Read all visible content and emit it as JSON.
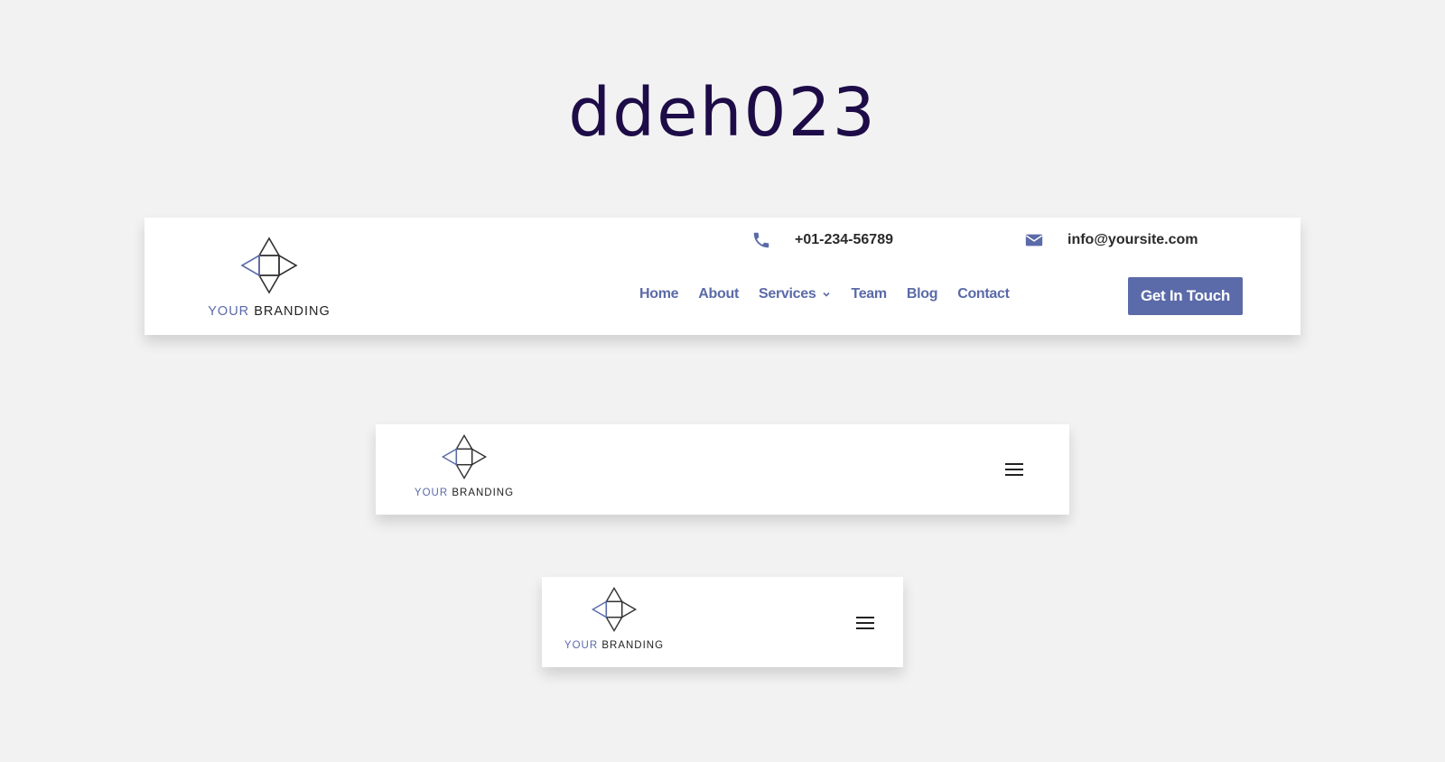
{
  "page": {
    "title": "ddeh023"
  },
  "branding": {
    "your": "YOUR",
    "brand": "BRANDING"
  },
  "header": {
    "phone": "+01-234-56789",
    "email": "info@yoursite.com",
    "nav": [
      {
        "label": "Home"
      },
      {
        "label": "About"
      },
      {
        "label": "Services",
        "has_dropdown": true
      },
      {
        "label": "Team"
      },
      {
        "label": "Blog"
      },
      {
        "label": "Contact"
      }
    ],
    "cta_label": "Get In Touch"
  },
  "icons": {
    "phone": "phone-icon",
    "email": "envelope-icon",
    "dropdown": "chevron-down-icon",
    "menu": "hamburger-menu-icon"
  },
  "colors": {
    "accent": "#5b6aa8",
    "title": "#1d0c47",
    "background": "#f2f2f2",
    "text_dark": "#2a2a2a"
  }
}
